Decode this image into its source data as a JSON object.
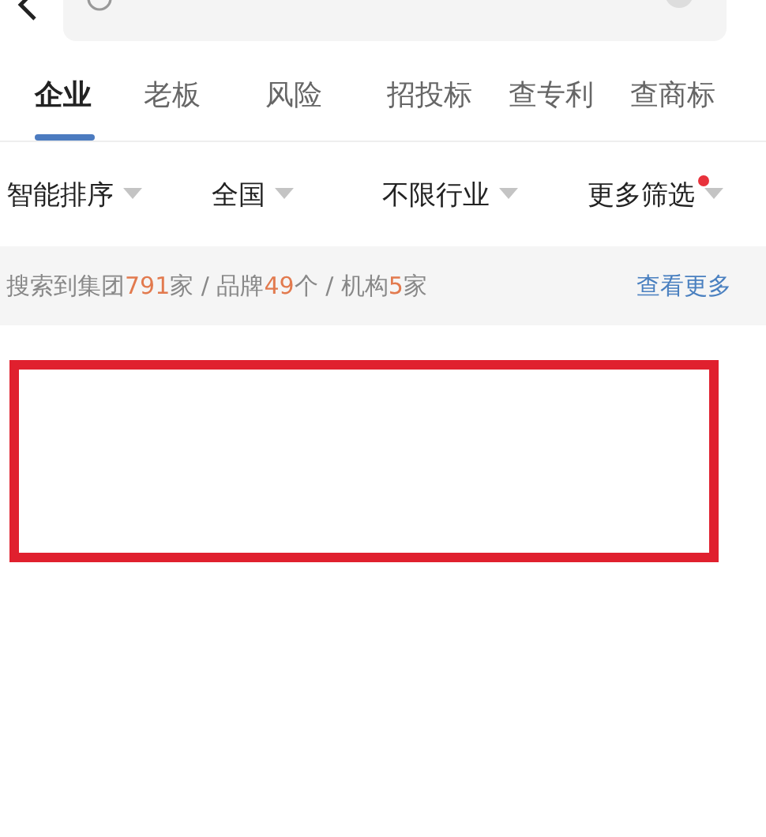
{
  "tabs": [
    {
      "label": "企业",
      "selected": true
    },
    {
      "label": "老板",
      "selected": false
    },
    {
      "label": "风险",
      "selected": false
    },
    {
      "label": "招投标",
      "selected": false
    },
    {
      "label": "查专利",
      "selected": false
    },
    {
      "label": "查商标",
      "selected": false
    }
  ],
  "filters": [
    {
      "label": "智能排序",
      "badge": false
    },
    {
      "label": "全国",
      "badge": false
    },
    {
      "label": "不限行业",
      "badge": false
    },
    {
      "label": "更多筛选",
      "badge": true
    }
  ],
  "summary": {
    "parts": [
      {
        "text": "搜索到集团",
        "highlight": false
      },
      {
        "text": "791",
        "highlight": true
      },
      {
        "text": "家 / 品牌",
        "highlight": false
      },
      {
        "text": "49",
        "highlight": true
      },
      {
        "text": "个 / 机构",
        "highlight": false
      },
      {
        "text": "5",
        "highlight": true
      },
      {
        "text": "家",
        "highlight": false
      }
    ],
    "link": "查看更多"
  }
}
